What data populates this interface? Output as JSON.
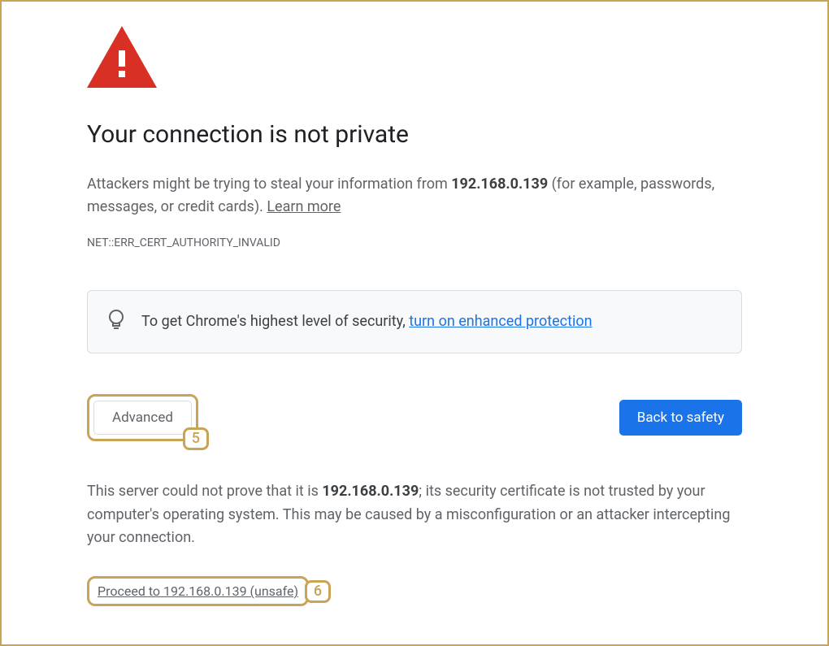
{
  "heading": "Your connection is not private",
  "description": {
    "prefix": "Attackers might be trying to steal your information from ",
    "ip": "192.168.0.139",
    "suffix": " (for example, passwords, messages, or credit cards). ",
    "learn_more": "Learn more"
  },
  "error_code": "NET::ERR_CERT_AUTHORITY_INVALID",
  "tip": {
    "prefix": "To get Chrome's highest level of security, ",
    "link": "turn on enhanced protection"
  },
  "buttons": {
    "advanced": "Advanced",
    "back_to_safety": "Back to safety"
  },
  "detail": {
    "prefix": "This server could not prove that it is ",
    "ip": "192.168.0.139",
    "suffix": "; its security certificate is not trusted by your computer's operating system. This may be caused by a misconfiguration or an attacker intercepting your connection."
  },
  "proceed_link": "Proceed to 192.168.0.139 (unsafe)",
  "annotations": {
    "five": "5",
    "six": "6"
  },
  "colors": {
    "warning_red": "#d93025",
    "primary_blue": "#1a73e8",
    "annotation_border": "#c9a356"
  }
}
